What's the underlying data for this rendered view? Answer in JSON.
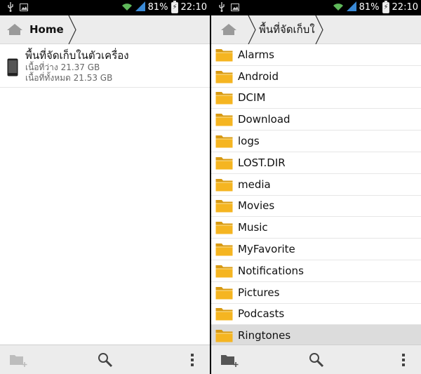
{
  "status": {
    "battery": "81%",
    "time": "22:10"
  },
  "left": {
    "breadcrumb": "Home",
    "storage": {
      "title": "พื้นที่จัดเก็บในตัวเครื่อง",
      "free": "เนื้อที่ว่าง 21.37 GB",
      "total": "เนื้อที่ทั้งหมด 21.53 GB"
    }
  },
  "right": {
    "breadcrumb": "พื้นที่จัดเก็บใ",
    "folders": [
      "Alarms",
      "Android",
      "DCIM",
      "Download",
      "logs",
      "LOST.DIR",
      "media",
      "Movies",
      "Music",
      "MyFavorite",
      "Notifications",
      "Pictures",
      "Podcasts",
      "Ringtones"
    ],
    "selected_folder": "Ringtones"
  },
  "icons": {
    "home": "home-icon",
    "folder": "folder-icon",
    "new_folder": "new-folder-icon",
    "search": "search-icon",
    "overflow": "overflow-menu-icon"
  },
  "colors": {
    "folder": "#f5b521",
    "bar": "#ececec"
  }
}
